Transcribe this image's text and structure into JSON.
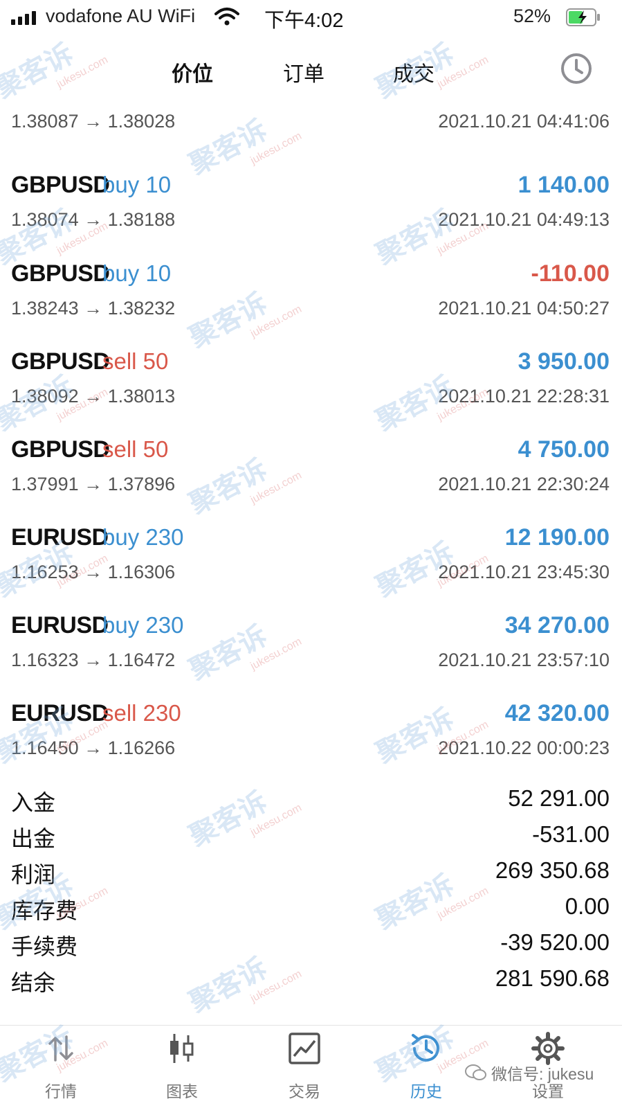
{
  "status_bar": {
    "carrier": "vodafone AU WiFi",
    "time": "下午4:02",
    "battery": "52%"
  },
  "header": {
    "tabs": [
      {
        "label": "价位",
        "active": true
      },
      {
        "label": "订单",
        "active": false
      },
      {
        "label": "成交",
        "active": false
      }
    ],
    "history_icon": "clock-icon"
  },
  "deals": [
    {
      "symbol": "GBPUSD",
      "side": "buy",
      "volume": "10",
      "side_label": "buy 10",
      "profit": "1 140.00",
      "profit_sign": "pos",
      "prices": "1.38074 → 1.38188",
      "time": "2021.10.21 04:49:13"
    },
    {
      "symbol": "GBPUSD",
      "side": "buy",
      "volume": "10",
      "side_label": "buy 10",
      "profit": "-110.00",
      "profit_sign": "neg",
      "prices": "1.38243 → 1.38232",
      "time": "2021.10.21 04:50:27"
    },
    {
      "symbol": "GBPUSD",
      "side": "sell",
      "volume": "50",
      "side_label": "sell 50",
      "profit": "3 950.00",
      "profit_sign": "pos",
      "prices": "1.38092 → 1.38013",
      "time": "2021.10.21 22:28:31"
    },
    {
      "symbol": "GBPUSD",
      "side": "sell",
      "volume": "50",
      "side_label": "sell 50",
      "profit": "4 750.00",
      "profit_sign": "pos",
      "prices": "1.37991 → 1.37896",
      "time": "2021.10.21 22:30:24"
    },
    {
      "symbol": "EURUSD",
      "side": "buy",
      "volume": "230",
      "side_label": "buy 230",
      "profit": "12 190.00",
      "profit_sign": "pos",
      "prices": "1.16253 → 1.16306",
      "time": "2021.10.21 23:45:30"
    },
    {
      "symbol": "EURUSD",
      "side": "buy",
      "volume": "230",
      "side_label": "buy 230",
      "profit": "34 270.00",
      "profit_sign": "pos",
      "prices": "1.16323 → 1.16472",
      "time": "2021.10.21 23:57:10"
    },
    {
      "symbol": "EURUSD",
      "side": "sell",
      "volume": "230",
      "side_label": "sell 230",
      "profit": "42 320.00",
      "profit_sign": "pos",
      "prices": "1.16450 → 1.16266",
      "time": "2021.10.22 00:00:23"
    }
  ],
  "partial_deal": {
    "prices": "1.38087 → 1.38028",
    "time": "2021.10.21 04:41:06"
  },
  "summary": [
    {
      "label": "入金",
      "value": "52 291.00"
    },
    {
      "label": "出金",
      "value": "-531.00"
    },
    {
      "label": "利润",
      "value": "269 350.68"
    },
    {
      "label": "库存费",
      "value": "0.00"
    },
    {
      "label": "手续费",
      "value": "-39 520.00"
    },
    {
      "label": "结余",
      "value": "281 590.68"
    }
  ],
  "bottom_nav": [
    {
      "label": "行情",
      "icon": "updown-arrows-icon",
      "active": false
    },
    {
      "label": "图表",
      "icon": "candlestick-icon",
      "active": false
    },
    {
      "label": "交易",
      "icon": "trade-chart-icon",
      "active": false
    },
    {
      "label": "历史",
      "icon": "history-clock-icon",
      "active": true
    },
    {
      "label": "设置",
      "icon": "gear-icon",
      "active": false
    }
  ],
  "wechat_mark": "微信号: jukesu",
  "watermark": {
    "text": "聚客诉",
    "sub": "jukesu.com"
  },
  "colors": {
    "buy": "#3b8fd0",
    "sell": "#d9584a",
    "active_nav": "#3b8fd0"
  }
}
